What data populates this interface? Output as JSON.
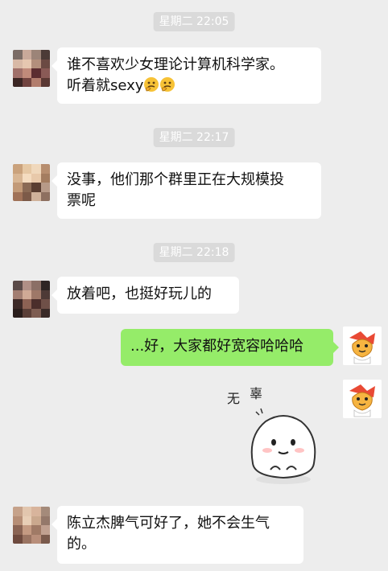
{
  "chat": {
    "timestamps": [
      "星期二 22:05",
      "星期二 22:17",
      "星期二 22:18"
    ],
    "messages": [
      {
        "line1": "谁不喜欢少女理论计算机科学家。",
        "line2": "听着就sexy",
        "emoji": "thinking-face-icon"
      },
      {
        "line1": "没事，他们那个群里正在大规模投",
        "line2": "票呢"
      },
      {
        "text": "放着吧，也挺好玩儿的"
      },
      {
        "text": "...好，大家都好宽容哈哈哈"
      },
      {
        "sticker_char1": "无",
        "sticker_char2": "辜"
      },
      {
        "line1": "陈立杰脾气可好了，她不会生气",
        "line2": "的。"
      }
    ]
  },
  "colors": {
    "background": "#ededed",
    "bubble_other": "#ffffff",
    "bubble_self": "#95ec69",
    "timestamp_bg": "#dadada"
  }
}
